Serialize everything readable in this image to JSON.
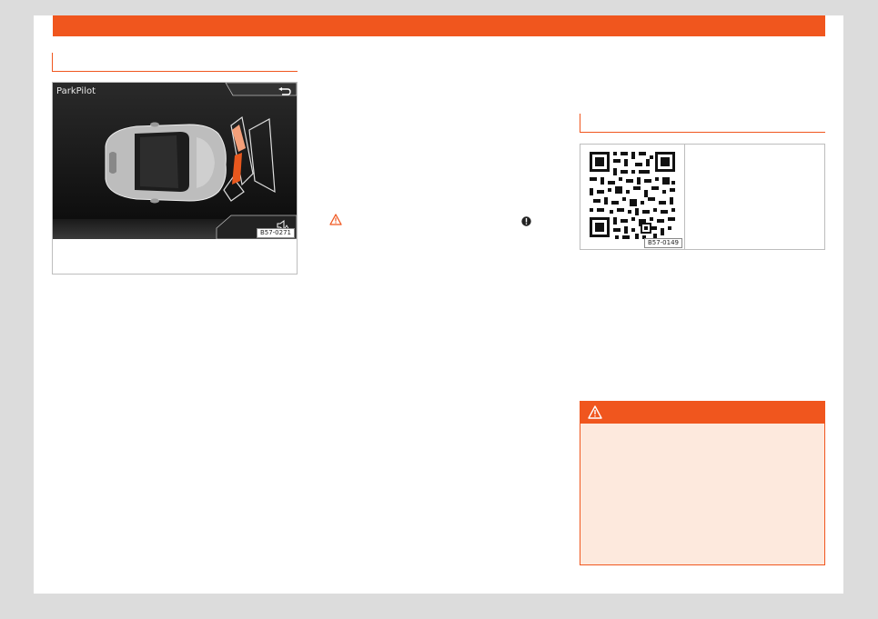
{
  "screen": {
    "title": "ParkPilot",
    "figure_code": "B57-0271"
  },
  "qr": {
    "figure_code": "B57-0149"
  },
  "icons": {
    "back": "back-arrow-icon",
    "sound": "speaker-icon",
    "warning": "warning-triangle-icon",
    "note": "exclamation-circle-icon"
  },
  "colors": {
    "accent": "#f0561e",
    "warning_bg": "#fde9dd"
  }
}
